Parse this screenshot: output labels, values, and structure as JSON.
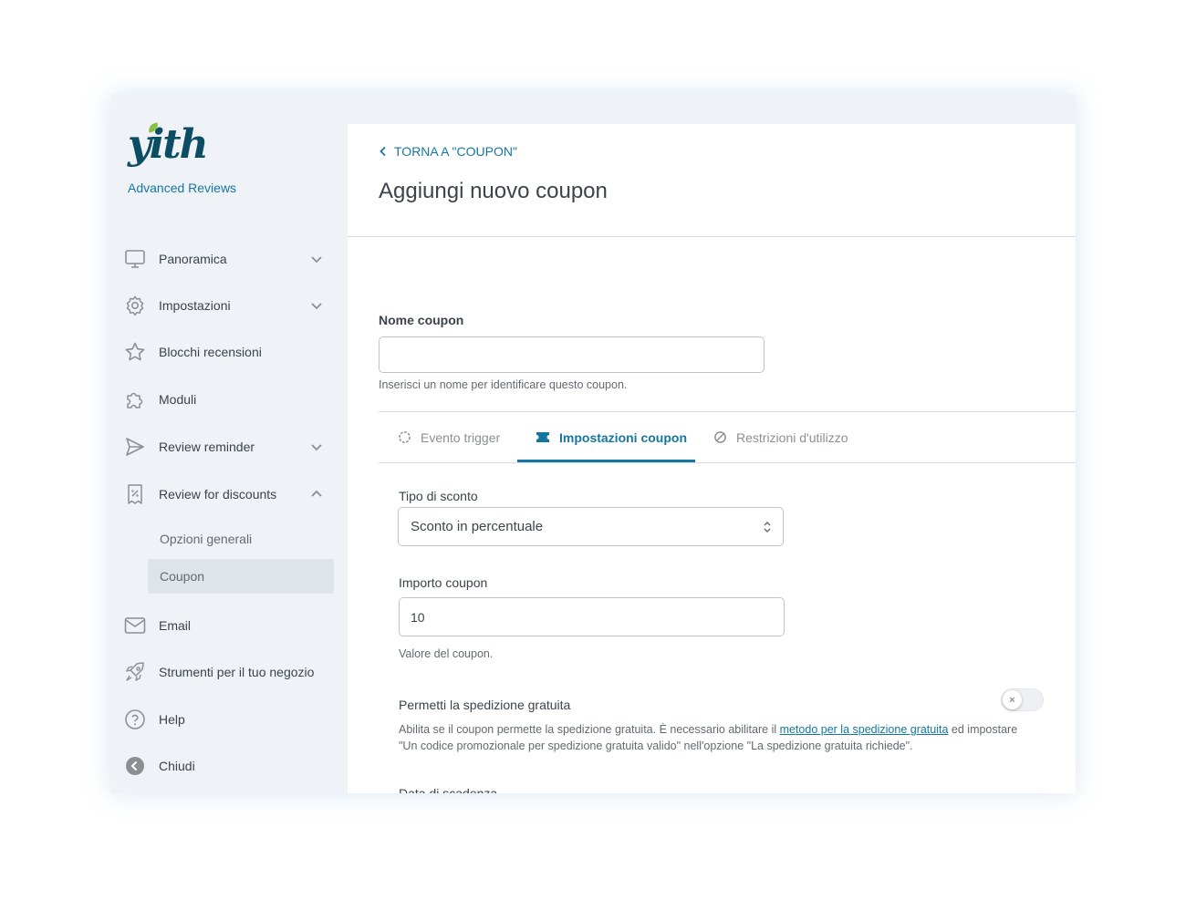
{
  "sidebar": {
    "brand_logo": "yith",
    "brand_subtitle": "Advanced Reviews",
    "items": [
      {
        "label": "Panoramica",
        "icon": "monitor-icon",
        "chevron": "down"
      },
      {
        "label": "Impostazioni",
        "icon": "gear-icon",
        "chevron": "down"
      },
      {
        "label": "Blocchi recensioni",
        "icon": "star-icon"
      },
      {
        "label": "Moduli",
        "icon": "puzzle-icon"
      },
      {
        "label": "Review reminder",
        "icon": "send-icon",
        "chevron": "down"
      },
      {
        "label": "Review for discounts",
        "icon": "discount-tag-icon",
        "chevron": "up"
      },
      {
        "label": "Email",
        "icon": "envelope-icon"
      },
      {
        "label": "Strumenti per il tuo negozio",
        "icon": "rocket-icon"
      },
      {
        "label": "Help",
        "icon": "help-circle-icon"
      },
      {
        "label": "Chiudi",
        "icon": "close-arrow-icon"
      }
    ],
    "subitems": [
      {
        "label": "Opzioni generali"
      },
      {
        "label": "Coupon",
        "active": true
      }
    ]
  },
  "header": {
    "back_label": "TORNA A \"COUPON\"",
    "title": "Aggiungi nuovo coupon"
  },
  "form": {
    "coupon_name": {
      "label": "Nome coupon",
      "value": "",
      "placeholder": "",
      "help": "Inserisci un nome per identificare questo coupon."
    },
    "tabs": [
      {
        "label": "Evento trigger",
        "icon": "circle-dashed-icon",
        "active": false
      },
      {
        "label": "Impostazioni coupon",
        "icon": "ticket-icon",
        "active": true
      },
      {
        "label": "Restrizioni d'utilizzo",
        "icon": "ban-icon",
        "active": false
      }
    ],
    "discount_type": {
      "label": "Tipo di sconto",
      "value": "Sconto in percentuale"
    },
    "coupon_amount": {
      "label": "Importo coupon",
      "value": "10",
      "help": "Valore del coupon."
    },
    "free_shipping": {
      "label": "Permetti la spedizione gratuita",
      "enabled": false,
      "toggle_symbol": "×",
      "desc_before": "Abilita se il coupon permette la spedizione gratuita. È necessario abilitare il ",
      "desc_link": "metodo per la spedizione gratuita",
      "desc_after": " ed impostare \"Un codice promozionale per spedizione gratuita valido\" nell'opzione \"La spedizione gratuita richiede\"."
    },
    "next_label_cut": "Data di scadenza"
  },
  "colors": {
    "accent": "#1577a1",
    "brand_dark": "#0b4d63",
    "brand_leaf": "#8ac142",
    "sidebar_bg": "#eff2f6"
  }
}
